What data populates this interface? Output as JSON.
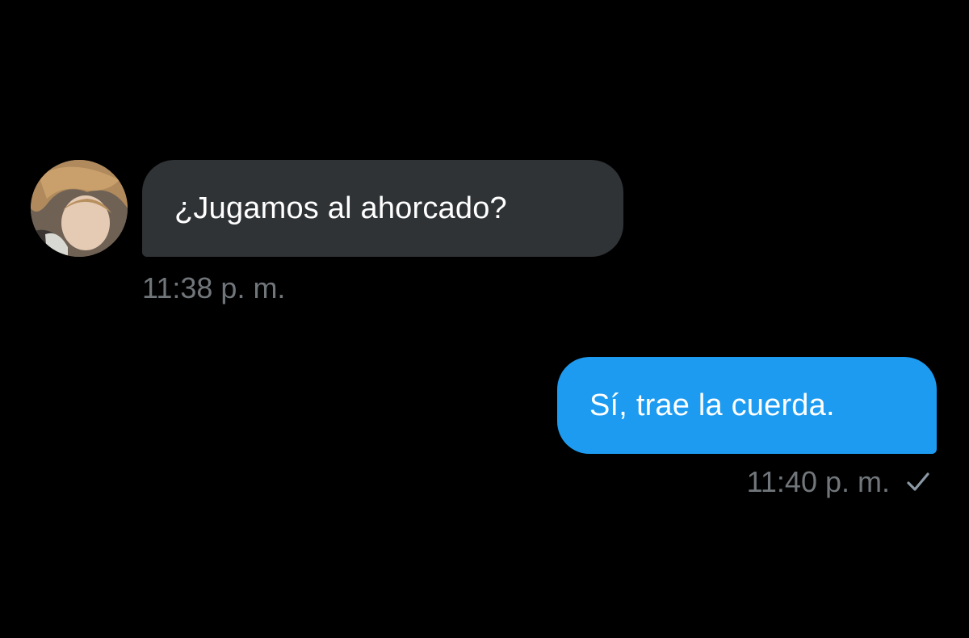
{
  "messages": [
    {
      "direction": "incoming",
      "text": "¿Jugamos al ahorcado?",
      "time": "11:38 p. m.",
      "avatar": "user-avatar-photo"
    },
    {
      "direction": "outgoing",
      "text": "Sí, trae la cuerda.",
      "time": "11:40 p. m.",
      "status_icon": "check-icon"
    }
  ],
  "colors": {
    "background": "#000000",
    "incoming_bubble": "#2f3336",
    "outgoing_bubble": "#1d9bf0",
    "text": "#ffffff",
    "timestamp": "#71767b"
  }
}
